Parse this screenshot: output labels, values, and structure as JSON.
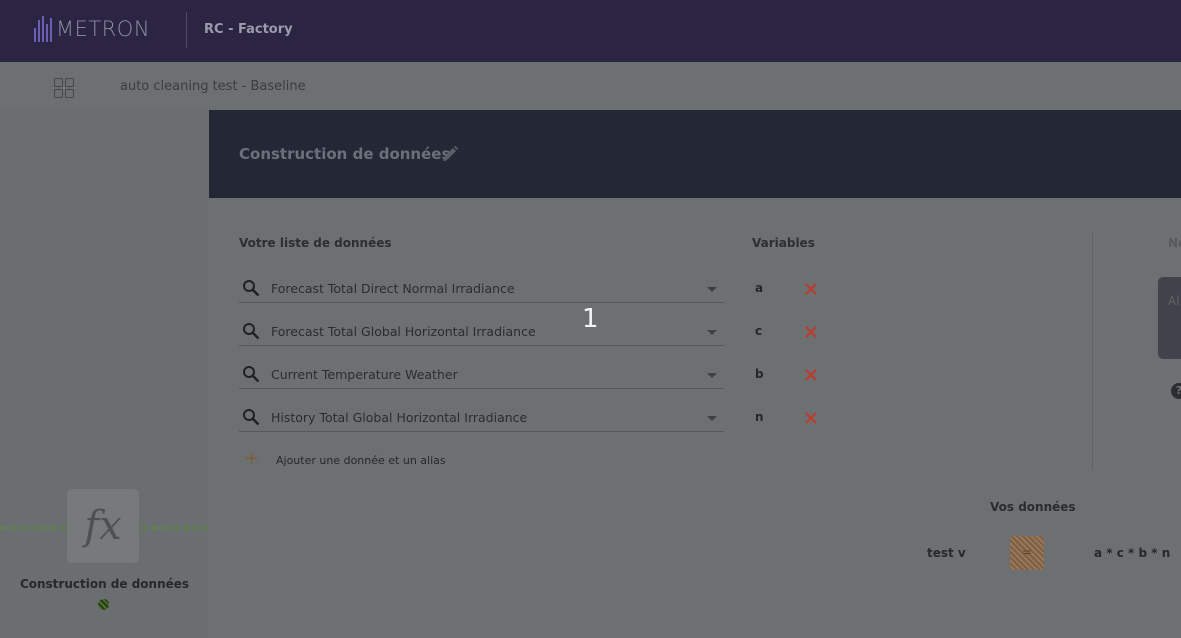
{
  "topbar": {
    "brand": "METRON",
    "project": "RC - Factory"
  },
  "subbar": {
    "breadcrumb": "auto cleaning test - Baseline"
  },
  "left_panel": {
    "node_symbol": "fx",
    "node_label": "Construction de données"
  },
  "main": {
    "title": "Construction de données",
    "list_header": "Votre liste de données",
    "variables_header": "Variables",
    "rows": [
      {
        "data": "Forecast Total Direct Normal Irradiance",
        "variable": "a"
      },
      {
        "data": "Forecast Total Global Horizontal Irradiance",
        "variable": "c"
      },
      {
        "data": "Current Temperature Weather",
        "variable": "b"
      },
      {
        "data": "History Total Global Horizontal Irradiance",
        "variable": "n"
      }
    ],
    "add_label": "Ajouter une donnée et un alias",
    "add_symbol": "+",
    "overlay_number": "1",
    "right_header": "Ne",
    "right_box_text": "Al",
    "help_symbol": "?"
  },
  "your_data": {
    "title": "Vos données",
    "items": [
      {
        "name": "test v",
        "operator": "=",
        "formula": "a * c * b * n"
      }
    ]
  },
  "colors": {
    "topbar": "#2c2443",
    "header": "#242836",
    "delete": "#c0392b",
    "accent": "#7a5f34"
  }
}
